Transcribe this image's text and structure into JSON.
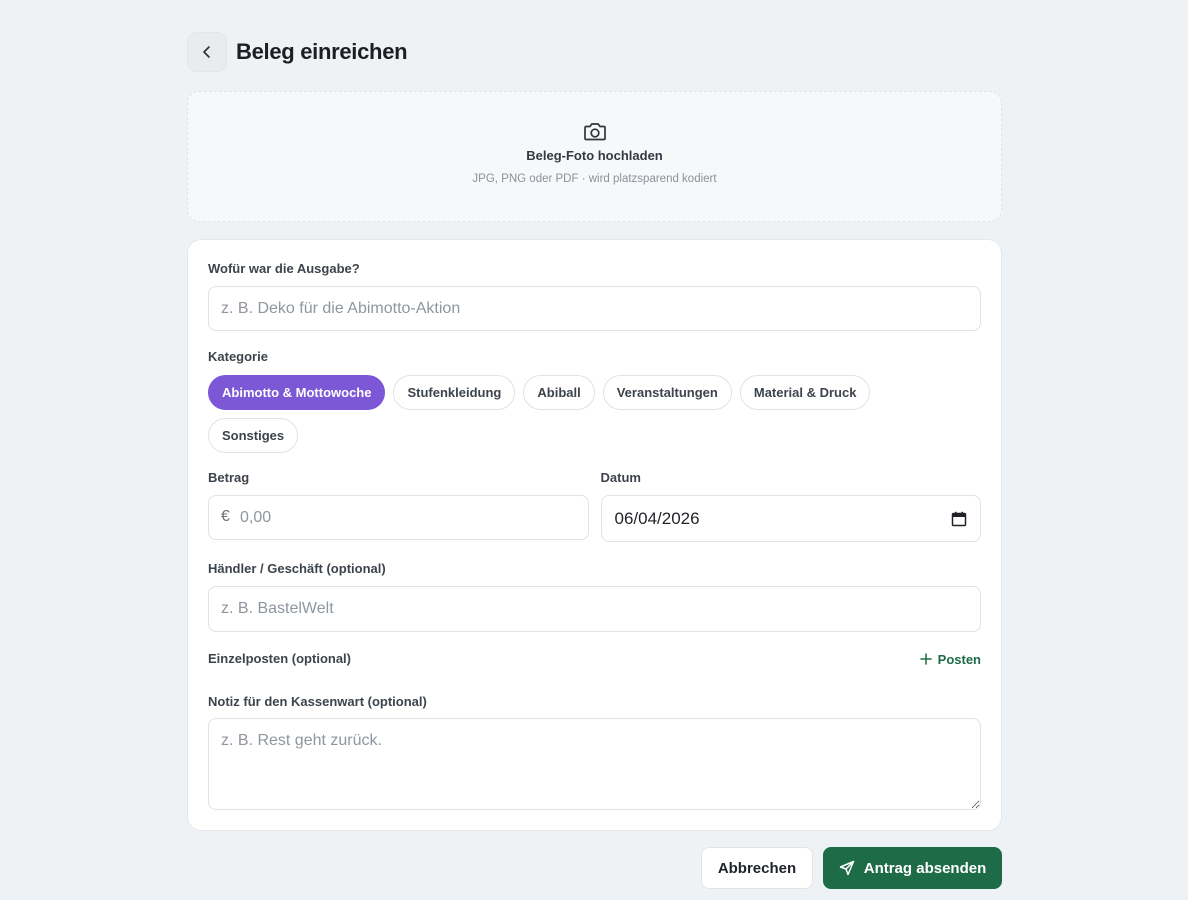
{
  "header": {
    "title": "Beleg einreichen",
    "back_icon": "chevron-left-icon"
  },
  "upload": {
    "icon": "camera-icon",
    "title": "Beleg-Foto hochladen",
    "hint": "JPG, PNG oder PDF · wird platzsparend kodiert"
  },
  "form": {
    "purpose": {
      "label": "Wofür war die Ausgabe?",
      "placeholder": "z. B. Deko für die Abimotto-Aktion",
      "value": ""
    },
    "category": {
      "label": "Kategorie",
      "options": [
        "Abimotto & Mottowoche",
        "Stufenkleidung",
        "Abiball",
        "Veranstaltungen",
        "Material & Druck",
        "Sonstiges"
      ],
      "selected": "Abimotto & Mottowoche"
    },
    "amount": {
      "label": "Betrag",
      "currency": "€",
      "placeholder": "0,00",
      "value": ""
    },
    "date": {
      "label": "Datum",
      "value": "06/04/2026",
      "icon": "calendar-icon"
    },
    "merchant": {
      "label": "Händler / Geschäft (optional)",
      "placeholder": "z. B. BastelWelt",
      "value": ""
    },
    "items": {
      "label": "Einzelposten (optional)",
      "add_label": "Posten",
      "add_icon": "plus-icon"
    },
    "note": {
      "label": "Notiz für den Kassenwart (optional)",
      "placeholder": "z. B. Rest geht zurück.",
      "value": ""
    }
  },
  "actions": {
    "cancel_label": "Abbrechen",
    "submit_label": "Antrag absenden",
    "submit_icon": "send-icon"
  },
  "colors": {
    "accent_purple": "#7c57d6",
    "primary_green": "#1e6b47",
    "background": "#eff2f4"
  }
}
